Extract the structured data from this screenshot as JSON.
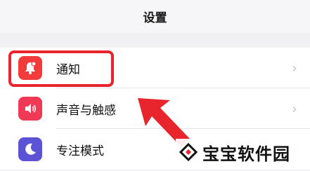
{
  "nav": {
    "title": "设置"
  },
  "settings": {
    "items": [
      {
        "label": "通知",
        "icon": "bell-badge-icon",
        "icon_color": "#f23c3c"
      },
      {
        "label": "声音与触感",
        "icon": "speaker-icon",
        "icon_color": "#f03a55"
      },
      {
        "label": "专注模式",
        "icon": "moon-icon",
        "icon_color": "#5b52d6"
      }
    ]
  },
  "annotation": {
    "highlight_color": "#e8242d"
  },
  "watermark": {
    "text": "宝宝软件园"
  }
}
